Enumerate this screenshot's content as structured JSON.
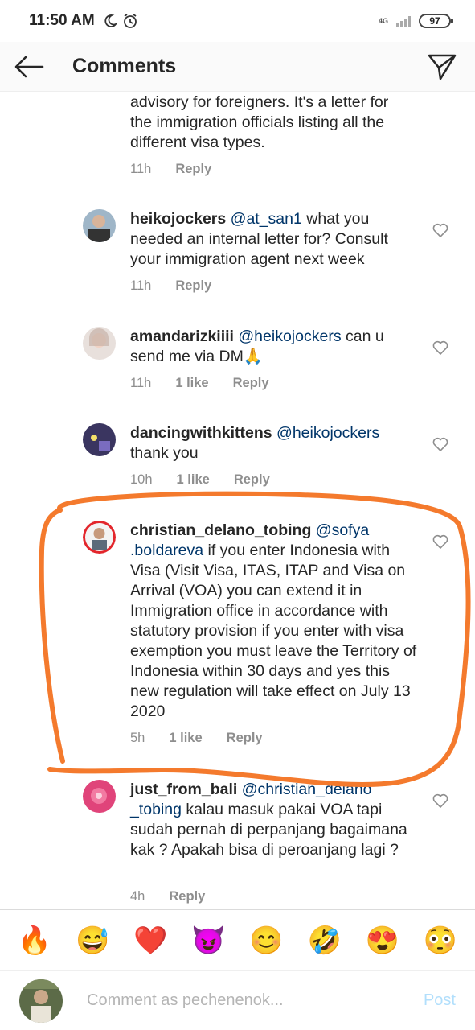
{
  "status_bar": {
    "time": "11:50 AM",
    "network": "4G",
    "battery": "97"
  },
  "header": {
    "title": "Comments"
  },
  "comments": [
    {
      "user": "",
      "mention": "",
      "lines": [
        "advisory for foreigners. It's a letter for",
        "the immigration officials listing all the",
        "different visa types."
      ],
      "time": "11h",
      "likes": "",
      "reply": "Reply"
    },
    {
      "user": "heikojockers",
      "mention": "@at_san1",
      "text": "what you needed an internal letter for? Consult your immigration agent next week",
      "time": "11h",
      "likes": "",
      "reply": "Reply"
    },
    {
      "user": "amandarizkiiii",
      "mention": "@heikojockers",
      "text": "can u send me via DM🙏",
      "time": "11h",
      "likes": "1 like",
      "reply": "Reply"
    },
    {
      "user": "dancingwithkittens",
      "mention": "@heikojockers",
      "text": "thank you",
      "time": "10h",
      "likes": "1 like",
      "reply": "Reply"
    },
    {
      "user": "christian_delano_tobing",
      "mention": "@sofya .boldareva",
      "text": "if you enter Indonesia with Visa (Visit Visa, ITAS, ITAP and Visa on Arrival (VOA) you can extend it in Immigration office in accordance with statutory provision if you enter with visa exemption you must leave the Territory of Indonesia within 30 days and yes this new regulation will take effect on July 13 2020",
      "time": "5h",
      "likes": "1 like",
      "reply": "Reply"
    },
    {
      "user": "just_from_bali",
      "mention": "@christian_delano _tobing",
      "text": "kalau masuk pakai VOA tapi sudah pernah di perpanjang bagaimana kak ? Apakah bisa di peroanjang lagi ?",
      "time": "4h",
      "likes": "",
      "reply": "Reply"
    }
  ],
  "emoji_bar": [
    "🔥",
    "😅",
    "❤️",
    "😈",
    "😊",
    "🤣",
    "😍",
    "😳"
  ],
  "input": {
    "placeholder": "Comment as pechenenok...",
    "post_label": "Post"
  },
  "colors": {
    "highlight": "#f47a2d",
    "mention": "#003569",
    "meta": "#8e8e8e",
    "post": "#b2dffc"
  }
}
